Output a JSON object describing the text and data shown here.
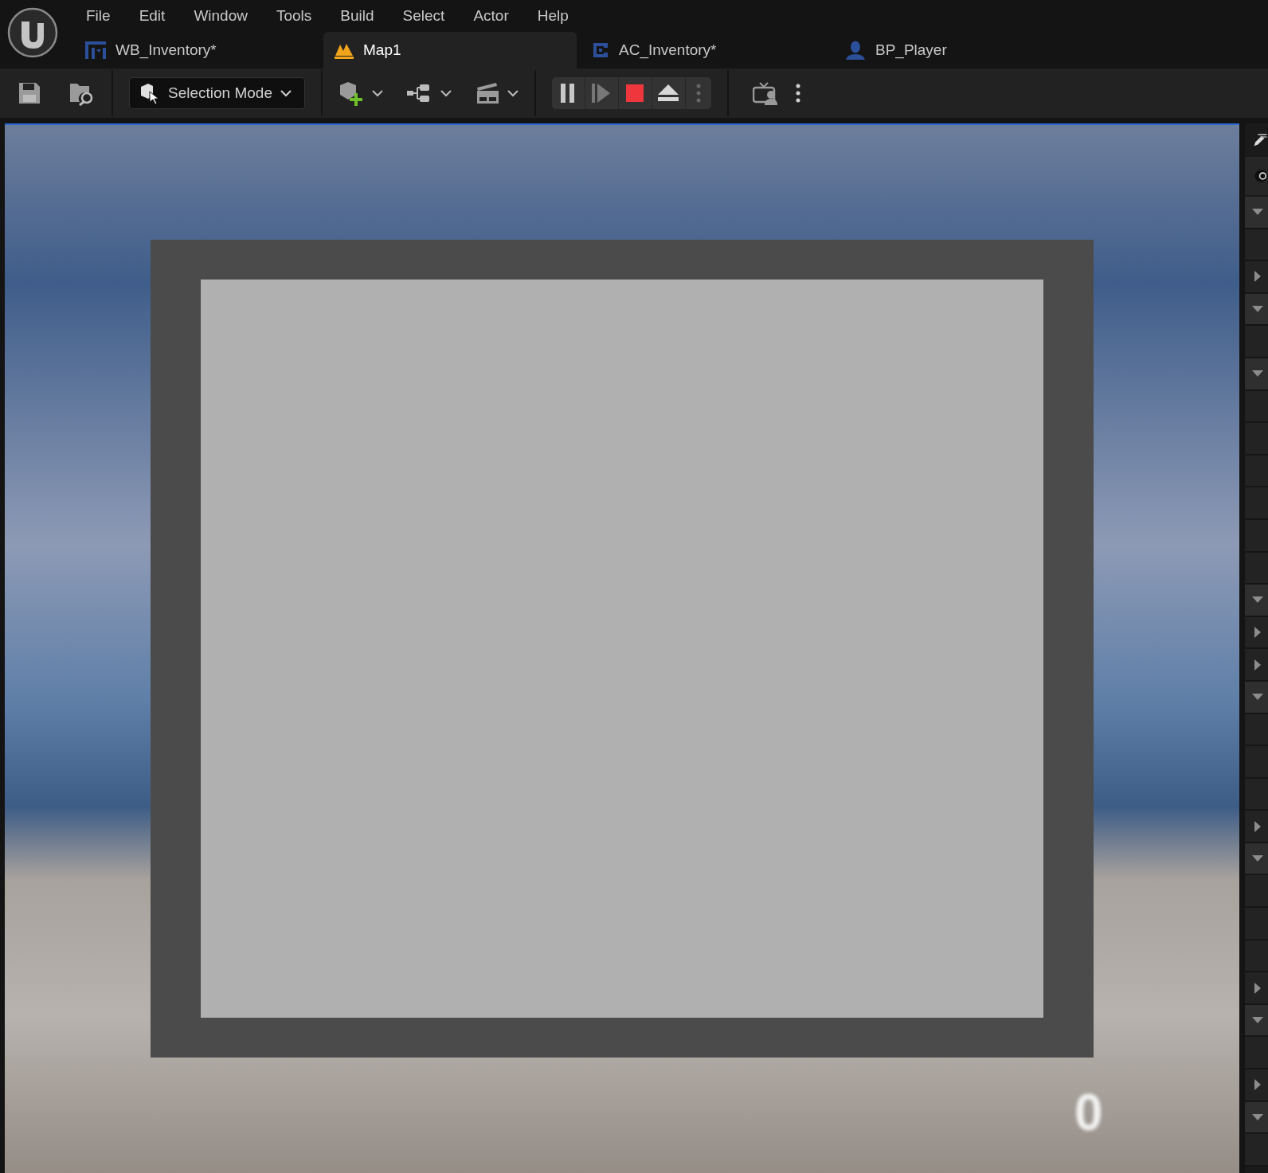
{
  "menu": [
    "File",
    "Edit",
    "Window",
    "Tools",
    "Build",
    "Select",
    "Actor",
    "Help"
  ],
  "tabs": [
    {
      "label": "WB_Inventory*",
      "kind": "widget",
      "selected": false
    },
    {
      "label": "Map1",
      "kind": "level",
      "selected": true
    },
    {
      "label": "AC_Inventory*",
      "kind": "component",
      "selected": false
    },
    {
      "label": "BP_Player",
      "kind": "character",
      "selected": false
    }
  ],
  "toolbar": {
    "mode": "Selection Mode"
  },
  "viewport": {
    "hud_text": "0"
  },
  "side_rows": [
    {
      "kind": "toggle",
      "expanded": true
    },
    {
      "kind": "empty"
    },
    {
      "kind": "toggle",
      "expanded": false
    },
    {
      "kind": "toggle",
      "expanded": true
    },
    {
      "kind": "empty"
    },
    {
      "kind": "toggle",
      "expanded": true
    },
    {
      "kind": "empty"
    },
    {
      "kind": "empty"
    },
    {
      "kind": "empty"
    },
    {
      "kind": "empty"
    },
    {
      "kind": "empty"
    },
    {
      "kind": "empty"
    },
    {
      "kind": "toggle",
      "expanded": true
    },
    {
      "kind": "toggle",
      "expanded": false
    },
    {
      "kind": "toggle",
      "expanded": false
    },
    {
      "kind": "toggle",
      "expanded": true
    },
    {
      "kind": "empty"
    },
    {
      "kind": "empty"
    },
    {
      "kind": "empty"
    },
    {
      "kind": "toggle",
      "expanded": false
    },
    {
      "kind": "toggle",
      "expanded": true
    },
    {
      "kind": "empty"
    },
    {
      "kind": "empty"
    },
    {
      "kind": "empty"
    },
    {
      "kind": "toggle",
      "expanded": false
    },
    {
      "kind": "toggle",
      "expanded": true
    },
    {
      "kind": "empty"
    },
    {
      "kind": "toggle",
      "expanded": false
    },
    {
      "kind": "toggle",
      "expanded": true
    },
    {
      "kind": "empty"
    }
  ]
}
